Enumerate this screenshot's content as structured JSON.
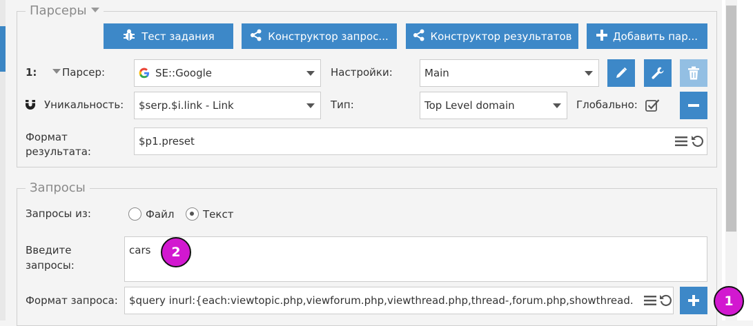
{
  "colors": {
    "accent": "#3d88c8",
    "disabled": "#93bfe3",
    "badge": "#d218d0"
  },
  "parsers": {
    "legend": "Парсеры",
    "buttons": {
      "test_task": "Тест задания",
      "query_builder": "Конструктор запрос...",
      "result_builder": "Конструктор результатов",
      "add_parser": "Добавить пар..."
    },
    "row1": {
      "index": "1:",
      "parser_label": "Парсер:",
      "parser_value": "SE::Google",
      "settings_label": "Настройки:",
      "settings_value": "Main"
    },
    "row2": {
      "uniqueness_label": "Уникальность:",
      "uniqueness_value": "$serp.$i.link - Link",
      "type_label": "Тип:",
      "type_value": "Top Level domain",
      "global_label": "Глобально:"
    },
    "format": {
      "label_line1": "Формат",
      "label_line2": "результата:",
      "value": "$p1.preset"
    }
  },
  "queries": {
    "legend": "Запросы",
    "source_label": "Запросы из:",
    "options": [
      "Файл",
      "Текст"
    ],
    "selected_option": "Текст",
    "enter_label_line1": "Введите",
    "enter_label_line2": "запросы:",
    "text_value": "cars",
    "format_label": "Формат запроса:",
    "format_value": "$query inurl:{each:viewtopic.php,viewforum.php,viewthread.php,thread-,forum.php,showthread.php"
  },
  "badges": {
    "b1": "1",
    "b2": "2"
  }
}
